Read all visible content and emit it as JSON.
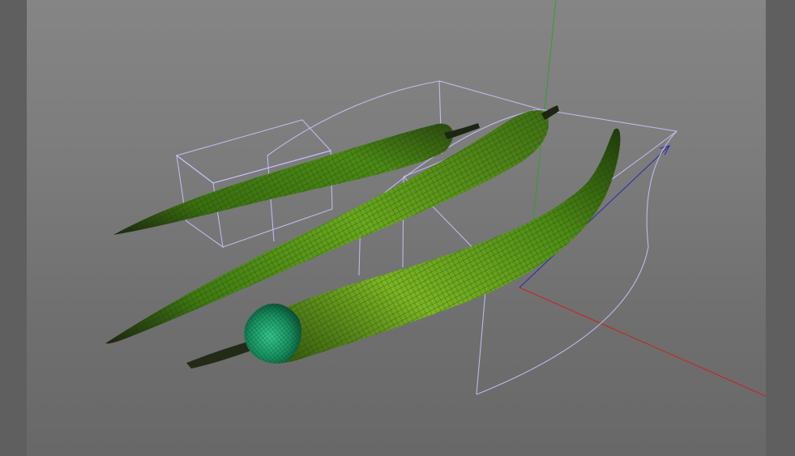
{
  "viewport": {
    "background": "#7a7a7a",
    "side_strip_color": "#5f5f5f",
    "axes": {
      "x_color": "#cc2020",
      "y_color": "#2fa02f",
      "z_color": "#2a2ab0"
    },
    "cage_color": "#c9c6ff",
    "objects": [
      {
        "name": "pepper-back",
        "body_color": "#3f7a12",
        "tip_color": "#1f2a12"
      },
      {
        "name": "pepper-middle",
        "body_color": "#4a8c16",
        "tip_color": "#1f2a12"
      },
      {
        "name": "pepper-front",
        "body_color": "#5c9e1a",
        "calyx_color": "#1e8a5a"
      }
    ]
  }
}
